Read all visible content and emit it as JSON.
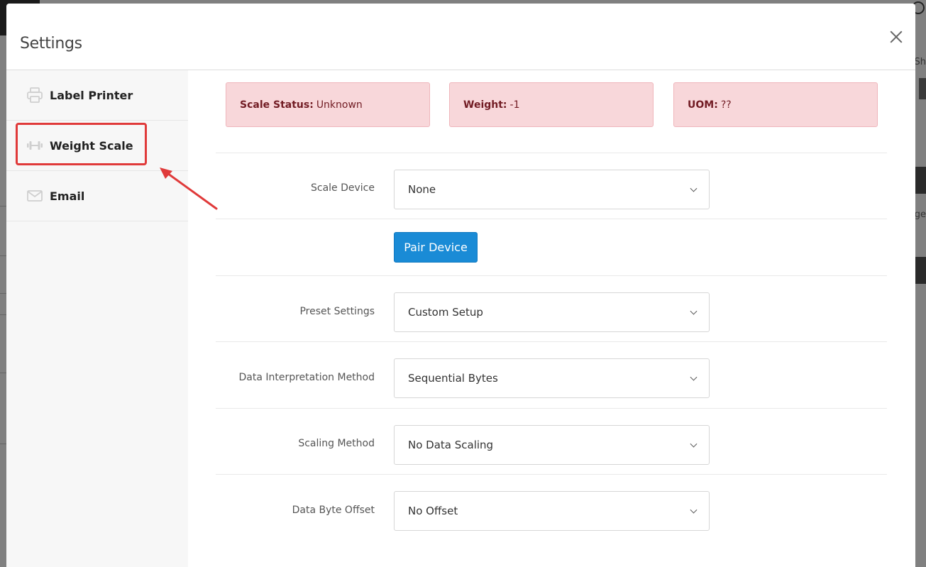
{
  "backdrop": {
    "right_text_1": "Sh",
    "right_text_2": "ge"
  },
  "modal": {
    "title": "Settings"
  },
  "sidebar": {
    "items": [
      {
        "label": "Label Printer",
        "icon": "printer-icon"
      },
      {
        "label": "Weight Scale",
        "icon": "dumbbell-icon"
      },
      {
        "label": "Email",
        "icon": "envelope-icon"
      }
    ],
    "selected": "Weight Scale"
  },
  "status": {
    "scale_status_label": "Scale Status:",
    "scale_status_value": "Unknown",
    "weight_label": "Weight:",
    "weight_value": "-1",
    "uom_label": "UOM:",
    "uom_value": "??"
  },
  "form": {
    "scale_device": {
      "label": "Scale Device",
      "value": "None"
    },
    "pair_button": "Pair Device",
    "preset_settings": {
      "label": "Preset Settings",
      "value": "Custom Setup"
    },
    "data_interpretation": {
      "label": "Data Interpretation Method",
      "value": "Sequential Bytes"
    },
    "scaling_method": {
      "label": "Scaling Method",
      "value": "No Data Scaling"
    },
    "data_byte_offset": {
      "label": "Data Byte Offset",
      "value": "No Offset"
    }
  },
  "colors": {
    "alert_bg": "#f8d7da",
    "alert_text": "#721c24",
    "primary": "#1a8bd6",
    "highlight": "#e03a3a"
  }
}
